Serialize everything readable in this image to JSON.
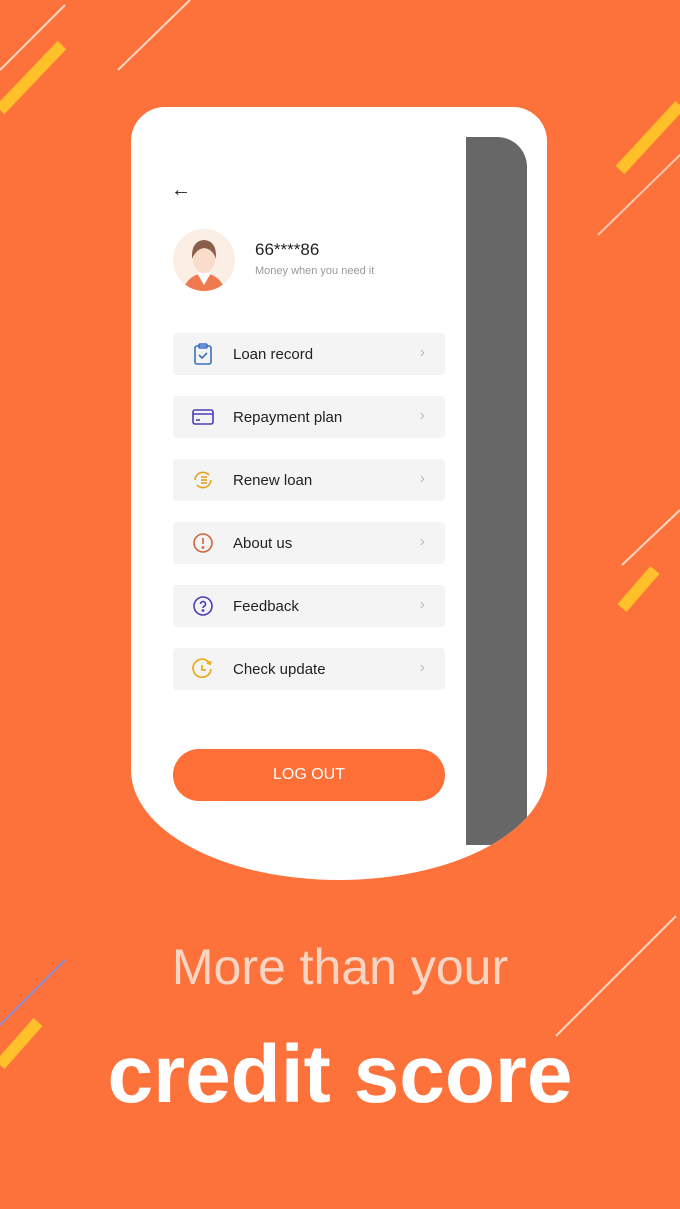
{
  "profile": {
    "back_icon": "arrow-left-icon",
    "username": "66****86",
    "tagline": "Money when you need it"
  },
  "menu": [
    {
      "label": "Loan record",
      "icon": "clipboard-check-icon",
      "color": "#3a6fc4"
    },
    {
      "label": "Repayment plan",
      "icon": "credit-card-icon",
      "color": "#4a3fb5"
    },
    {
      "label": "Renew loan",
      "icon": "renew-list-icon",
      "color": "#e8a020"
    },
    {
      "label": "About us",
      "icon": "info-exclamation-icon",
      "color": "#d0643c"
    },
    {
      "label": "Feedback",
      "icon": "question-circle-icon",
      "color": "#4a3fb5"
    },
    {
      "label": "Check update",
      "icon": "clock-refresh-icon",
      "color": "#e8b020"
    }
  ],
  "logout_label": "LOG OUT",
  "headline": "More than your",
  "subheadline": "credit score",
  "colors": {
    "background": "#fd723a",
    "accent": "#fd6f36"
  }
}
